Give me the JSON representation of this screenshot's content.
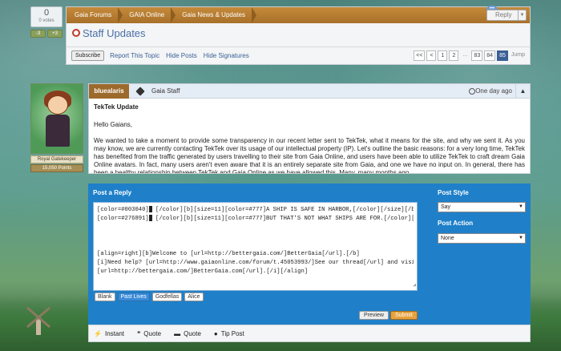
{
  "vote": {
    "count": "0",
    "label": "0 votes",
    "down_label": "-3",
    "up_label": "+3"
  },
  "breadcrumb": [
    "Gaia Forums",
    "GAIA Online",
    "Gaia News & Updates"
  ],
  "reply_button": "Reply",
  "thread": {
    "title": "Staff Updates"
  },
  "actions": {
    "subscribe": "Subscribe",
    "report": "Report This Topic",
    "hide_posts": "Hide Posts",
    "hide_signatures": "Hide Signatures"
  },
  "pager": [
    "<<",
    "<",
    "1",
    "2",
    "...",
    "83",
    "84",
    "85",
    "Jump"
  ],
  "poster": {
    "rank_title": "Royal Gatekeeper",
    "points": "15,050 Points"
  },
  "post": {
    "username": "bluealaris",
    "group": "Gaia Staff",
    "time": "One day ago",
    "title": "TekTek Update",
    "greeting": "Hello Gaians,",
    "body": "We wanted to take a moment to provide some transparency in our recent letter sent to TekTek, what it means for the site, and why we sent it. As you may know, we are currently contacting TekTek over its usage of our intellectual property (IP). Let's outline the basic reasons: for a very long time, TekTek has benefited from the traffic generated by users travelling to their site from Gaia Online, and users have been able to utilize TekTek to craft dream Gaia Online avatars. In fact, many users aren't even aware that it is an entirely separate site from Gaia, and one we have no input on. In general, there has been a healthy relationship between TekTek and Gaia Online as we have allowed this. Many, many months ago,"
  },
  "reply": {
    "title": "Post a Reply",
    "lines": [
      "[color=#003040]",
      "[/color][b][size=11][color=#777]A SHIP IS SAFE IN HARBOR,[/color][/size][/b]",
      "[color=#276891]",
      "[/color][b][size=11][color=#777]BUT THAT'S NOT WHAT SHIPS ARE FOR.[/color][/size][/b]",
      "[align=right][b]Welcome to [url=http://bettergaia.com/]BetterGaia[/url].[/b]",
      "[i]Need help? [url=http://www.gaiaonline.com/forum/t.45053993/]See our thread[/url] and visit",
      "[url=http://bettergaia.com/]BetterGaia.com[/url].[/i][/align]"
    ],
    "presets": [
      "Blank",
      "Past Lives",
      "Godfellas",
      "Alice"
    ],
    "preview": "Preview",
    "submit": "Submit",
    "post_style_label": "Post Style",
    "post_style_value": "Say",
    "post_action_label": "Post Action",
    "post_action_value": "None"
  },
  "tools": [
    "Instant",
    "Quote",
    "Quote",
    "Tip Post"
  ]
}
